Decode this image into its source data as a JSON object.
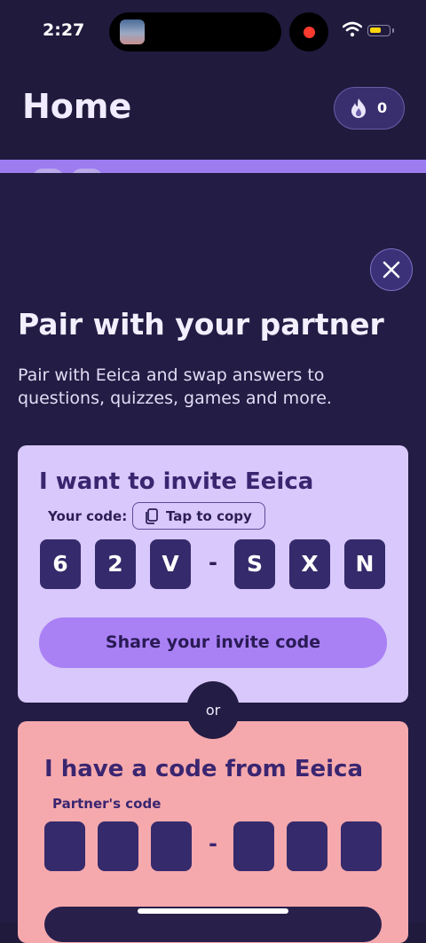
{
  "status_bar": {
    "time": "2:27"
  },
  "header": {
    "title": "Home",
    "streak_count": "0"
  },
  "pair_sheet": {
    "title": "Pair with your partner",
    "description": "Pair with Eeica and swap answers to questions, quizzes, games and more.",
    "invite": {
      "title": "I want to invite Eeica",
      "your_code_label": "Your code:",
      "copy_label": "Tap to copy",
      "code": [
        "6",
        "2",
        "V",
        "-",
        "S",
        "X",
        "N"
      ],
      "share_label": "Share your invite code"
    },
    "or_label": "or",
    "partner": {
      "title": "I have a code from Eeica",
      "code_label": "Partner's code",
      "dash": "-"
    }
  },
  "colors": {
    "background": "#201a3d",
    "invite_card": "#d8c8fb",
    "partner_card": "#f5a9ad",
    "code_box": "#352a6b",
    "share_button": "#a981f5",
    "accent_strip": "#9d7cf0"
  },
  "icons": {
    "streak": "flame-icon",
    "close": "close-icon",
    "copy": "copy-icon"
  }
}
